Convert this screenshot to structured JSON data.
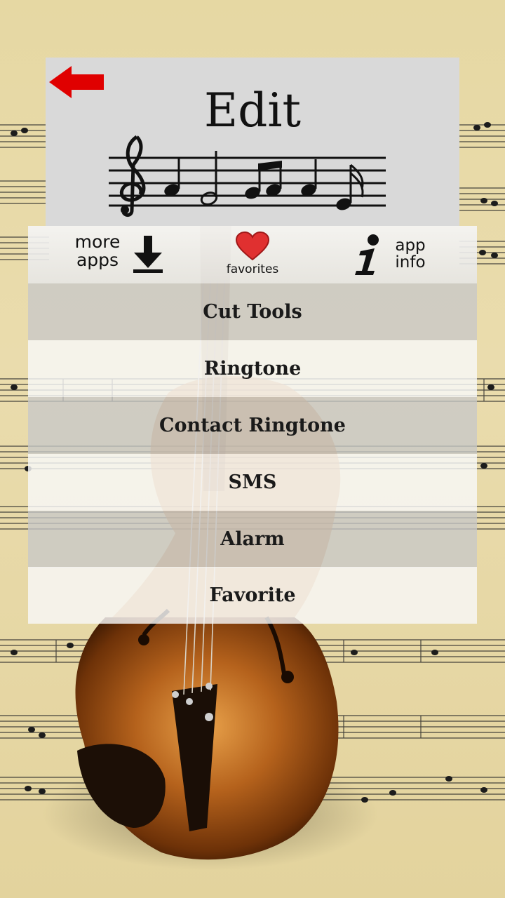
{
  "header": {
    "title": "Edit",
    "back_icon": "back-arrow-icon"
  },
  "toolbar": {
    "more_apps_line1": "more",
    "more_apps_line2": "apps",
    "favorites_label": "favorites",
    "app_info_line1": "app",
    "app_info_line2": "info"
  },
  "menu": {
    "items": [
      {
        "label": "Cut Tools"
      },
      {
        "label": "Ringtone"
      },
      {
        "label": "Contact Ringtone"
      },
      {
        "label": "SMS"
      },
      {
        "label": "Alarm"
      },
      {
        "label": "Favorite"
      }
    ]
  },
  "colors": {
    "background": "#e6d8a3",
    "header_bg": "#d9d9d9",
    "back_arrow": "#e00000",
    "heart": "#e03030"
  }
}
